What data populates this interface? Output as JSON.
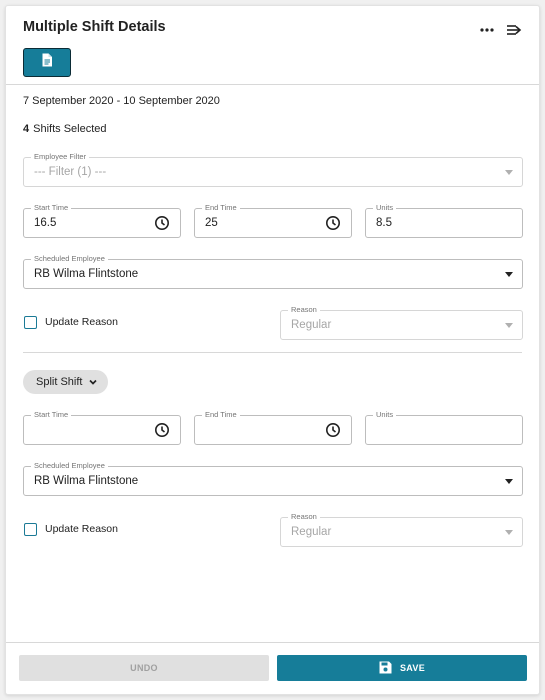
{
  "header": {
    "title": "Multiple Shift Details",
    "more_icon": "more-horizontal-icon",
    "collapse_icon": "arrow-collapse-right-icon",
    "doc_button_icon": "document-icon"
  },
  "summary": {
    "date_range": "7 September 2020 - 10 September 2020",
    "shift_count": "4",
    "shifts_selected_label": "Shifts Selected"
  },
  "employee_filter": {
    "label": "Employee Filter",
    "value": "--- Filter (1) ---"
  },
  "shift1": {
    "start_time": {
      "label": "Start Time",
      "value": "16.5"
    },
    "end_time": {
      "label": "End Time",
      "value": "25"
    },
    "units": {
      "label": "Units",
      "value": "8.5"
    },
    "scheduled_employee": {
      "label": "Scheduled Employee",
      "value": "RB Wilma Flintstone"
    },
    "update_reason_label": "Update Reason",
    "reason": {
      "label": "Reason",
      "value": "Regular"
    }
  },
  "split_shift_label": "Split Shift",
  "shift2": {
    "start_time": {
      "label": "Start Time",
      "value": ""
    },
    "end_time": {
      "label": "End Time",
      "value": ""
    },
    "units": {
      "label": "Units",
      "value": ""
    },
    "scheduled_employee": {
      "label": "Scheduled Employee",
      "value": "RB Wilma Flintstone"
    },
    "update_reason_label": "Update Reason",
    "reason": {
      "label": "Reason",
      "value": "Regular"
    }
  },
  "footer": {
    "undo_label": "UNDO",
    "save_label": "SAVE",
    "save_icon": "floppy-disk-icon"
  },
  "colors": {
    "accent": "#167d99",
    "disabled_bg": "#e0e0e0"
  }
}
